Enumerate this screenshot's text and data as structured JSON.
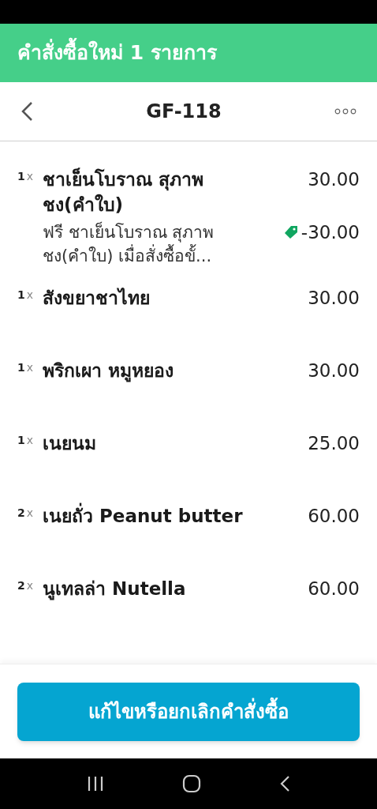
{
  "banner": {
    "title": "คำสั่งซื้อใหม่ 1 รายการ"
  },
  "nav": {
    "title": "GF-118"
  },
  "items": [
    {
      "qty": "1",
      "x": "x",
      "name": "ชาเย็นโบราณ สุภาพชง(คำใบ)",
      "price": "30.00",
      "discount": {
        "text": "ฟรี ชาเย็นโบราณ สุภาพชง(คำใบ) เมื่อสั่งซื้อขั้...",
        "amount": "-30.00"
      }
    },
    {
      "qty": "1",
      "x": "x",
      "name": "สังขยาชาไทย",
      "price": "30.00"
    },
    {
      "qty": "1",
      "x": "x",
      "name": "พริกเผา หมูหยอง",
      "price": "30.00"
    },
    {
      "qty": "1",
      "x": "x",
      "name": "เนยนม",
      "price": "25.00"
    },
    {
      "qty": "2",
      "x": "x",
      "name": "เนยถั่ว Peanut butter",
      "price": "60.00"
    },
    {
      "qty": "2",
      "x": "x",
      "name": "นูเทลล่า Nutella",
      "price": "60.00"
    }
  ],
  "action_button": {
    "label": "แก้ไขหรือยกเลิกคำสั่งซื้อ"
  }
}
